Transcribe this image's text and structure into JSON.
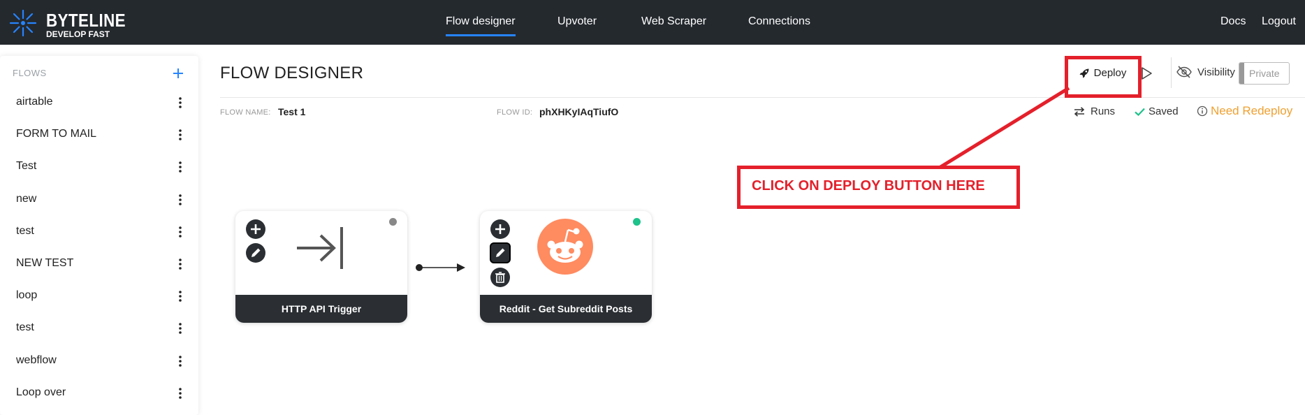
{
  "app": {
    "brand": "BYTELINE",
    "tagline": "DEVELOP FAST"
  },
  "nav": {
    "items": [
      {
        "label": "Flow designer",
        "active": true
      },
      {
        "label": "Upvoter",
        "active": false
      },
      {
        "label": "Web Scraper",
        "active": false
      },
      {
        "label": "Connections",
        "active": false
      }
    ],
    "docs": "Docs",
    "logout": "Logout"
  },
  "sidebar": {
    "header": "FLOWS",
    "add_icon": "plus-icon",
    "items": [
      {
        "label": "airtable"
      },
      {
        "label": "FORM TO MAIL"
      },
      {
        "label": "Test"
      },
      {
        "label": "new"
      },
      {
        "label": "test"
      },
      {
        "label": "NEW TEST"
      },
      {
        "label": "loop"
      },
      {
        "label": "test"
      },
      {
        "label": "webflow"
      },
      {
        "label": "Loop over"
      }
    ]
  },
  "main": {
    "title": "FLOW DESIGNER",
    "deploy_label": "Deploy",
    "visibility_label": "Visibility",
    "visibility_value": "Private",
    "flow_name_label": "FLOW NAME:",
    "flow_name": "Test 1",
    "flow_id_label": "FLOW ID:",
    "flow_id": "phXHKyIAqTiufO",
    "runs_label": "Runs",
    "saved_label": "Saved",
    "redeploy_label": "Need Redeploy"
  },
  "nodes": [
    {
      "label": "HTTP API Trigger",
      "icon": "arrow-to-bar-icon",
      "status_color": "#888888"
    },
    {
      "label": "Reddit - Get Subreddit Posts",
      "icon": "reddit-icon",
      "status_color": "#1ec28b"
    }
  ],
  "annotation": {
    "text": "CLICK ON DEPLOY BUTTON HERE",
    "color": "#e4202b"
  },
  "colors": {
    "navbar": "#24292e",
    "accent": "#2684ff",
    "warning": "#f0a030",
    "success": "#1ec28b",
    "reddit": "#ff8b60"
  }
}
